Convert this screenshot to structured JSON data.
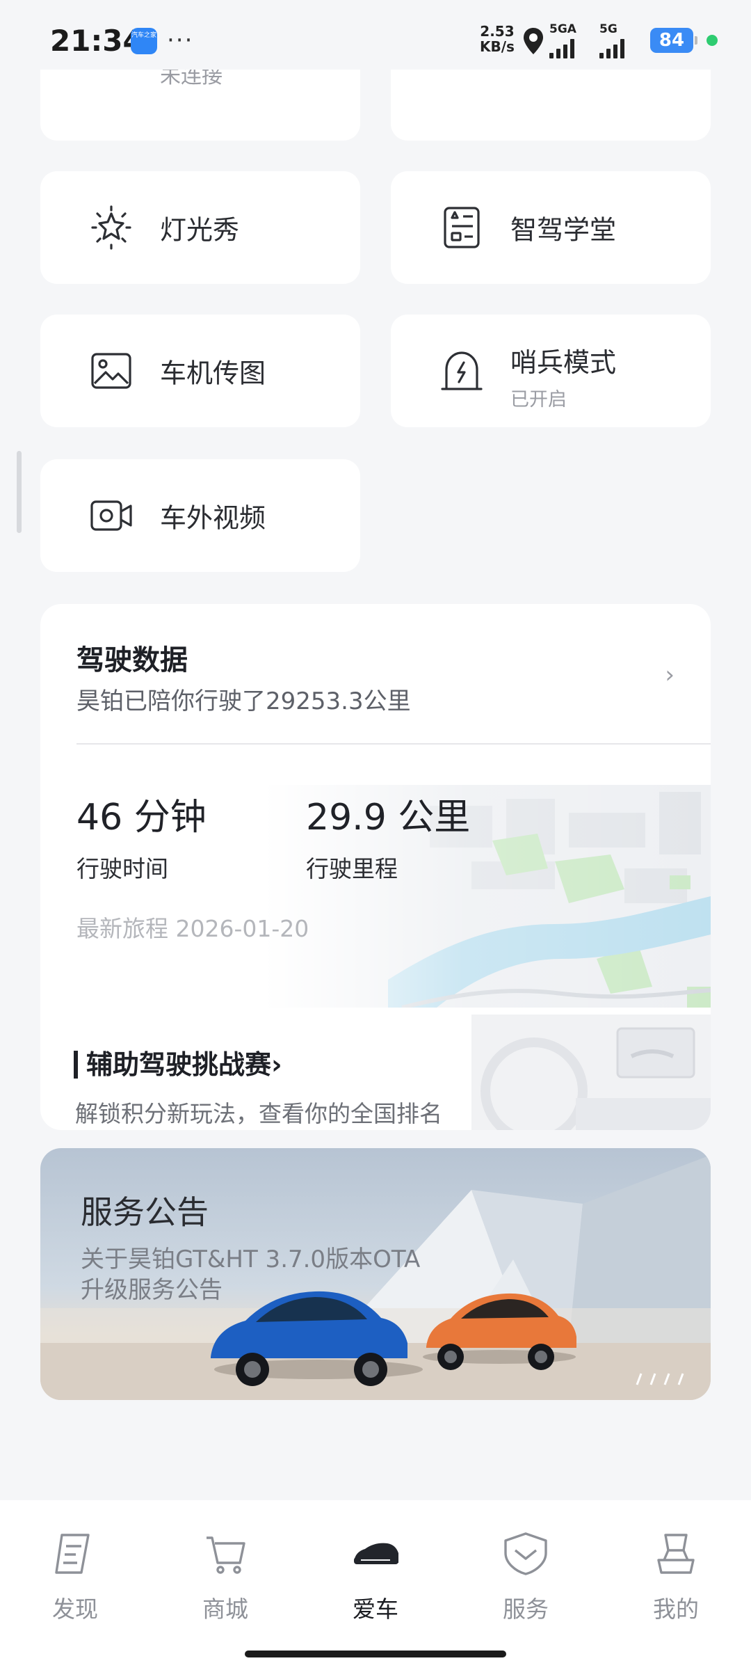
{
  "status_bar": {
    "time": "21:34",
    "app_icon_text": "汽车之家",
    "more": "···",
    "net_speed": "2.53",
    "net_unit": "KB/s",
    "sim1": "5GA",
    "sim2": "5G",
    "battery": "84"
  },
  "top_partial": {
    "left_text": "未连接"
  },
  "features": [
    {
      "label": "灯光秀",
      "icon": "sparkle-light-icon"
    },
    {
      "label": "智驾学堂",
      "icon": "course-book-icon"
    },
    {
      "label": "车机传图",
      "icon": "image-icon"
    },
    {
      "label": "哨兵模式",
      "sub": "已开启",
      "icon": "sentry-shield-icon"
    },
    {
      "label": "车外视频",
      "icon": "camera-video-icon"
    }
  ],
  "driving": {
    "title": "驾驶数据",
    "subtitle": "昊铂已陪你行驶了29253.3公里",
    "chevron": "›",
    "time_value": "46 分钟",
    "time_label": "行驶时间",
    "distance_value": "29.9 公里",
    "distance_label": "行驶里程",
    "latest_trip": "最新旅程 2026-01-20",
    "challenge_title": "辅助驾驶挑战赛",
    "challenge_chevron": "›",
    "challenge_sub": "解锁积分新玩法，查看你的全国排名"
  },
  "notice": {
    "title": "服务公告",
    "body": "关于昊铂GT&HT 3.7.0版本OTA升级服务公告"
  },
  "tabs": [
    {
      "label": "发现",
      "icon": "discover-icon",
      "active": false
    },
    {
      "label": "商城",
      "icon": "shop-cart-icon",
      "active": false
    },
    {
      "label": "爱车",
      "icon": "car-icon",
      "active": true
    },
    {
      "label": "服务",
      "icon": "service-heart-icon",
      "active": false
    },
    {
      "label": "我的",
      "icon": "profile-icon",
      "active": false
    }
  ]
}
